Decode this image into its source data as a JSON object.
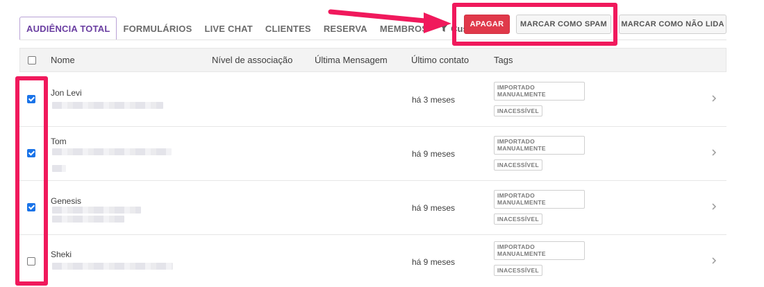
{
  "tabs": [
    {
      "label": "AUDIÊNCIA TOTAL"
    },
    {
      "label": "FORMULÁRIOS"
    },
    {
      "label": "LIVE CHAT"
    },
    {
      "label": "CLIENTES"
    },
    {
      "label": "RESERVA"
    },
    {
      "label": "MEMBROS"
    }
  ],
  "filter_label": "Custom",
  "actions": {
    "delete_label": "APAGAR",
    "spam_label": "MARCAR COMO SPAM",
    "unread_label": "MARCAR COMO NÃO LIDA"
  },
  "table": {
    "columns": [
      "Nome",
      "Nível de associação",
      "Última Mensagem",
      "Último contato",
      "Tags"
    ],
    "rows": [
      {
        "name": "Jon Levi",
        "last_contact": "há 3 meses",
        "tags": [
          "IMPORTADO MANUALMENTE",
          "INACESSÍVEL"
        ],
        "checked": true
      },
      {
        "name": "Tom",
        "last_contact": "há 9 meses",
        "tags": [
          "IMPORTADO MANUALMENTE",
          "INACESSÍVEL"
        ],
        "checked": true
      },
      {
        "name": "Genesis",
        "last_contact": "há 9 meses",
        "tags": [
          "IMPORTADO MANUALMENTE",
          "INACESSÍVEL"
        ],
        "checked": true
      },
      {
        "name": "Sheki",
        "last_contact": "há 9 meses",
        "tags": [
          "IMPORTADO MANUALMENTE",
          "INACESSÍVEL"
        ],
        "checked": false
      }
    ]
  },
  "colors": {
    "accent": "#6a3ea1",
    "danger": "#e0394a",
    "highlight": "#f0195c",
    "checkbox": "#1a73e8"
  }
}
